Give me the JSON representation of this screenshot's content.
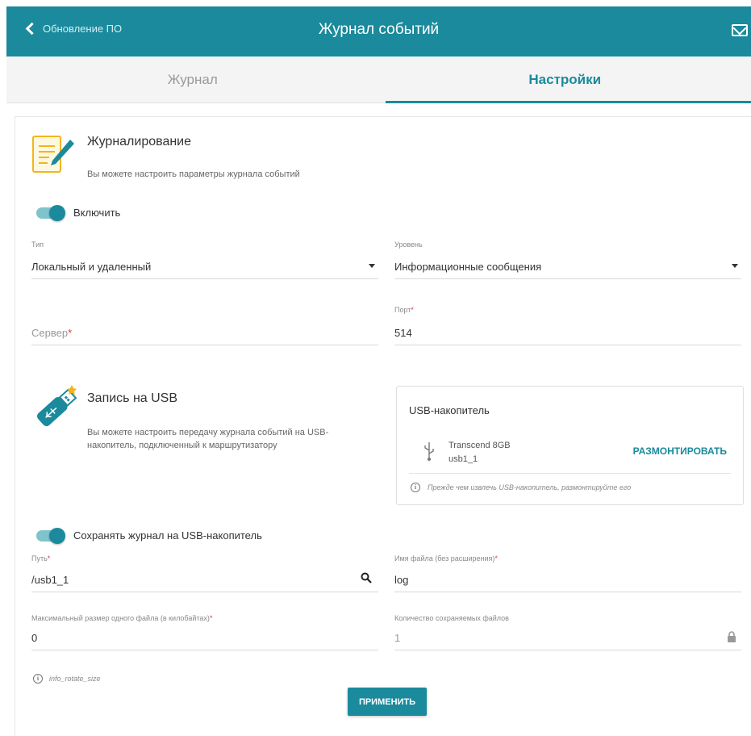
{
  "header": {
    "back_label": "Обновление ПО",
    "title": "Журнал событий"
  },
  "tabs": [
    {
      "label": "Журнал",
      "active": false
    },
    {
      "label": "Настройки",
      "active": true
    }
  ],
  "logging": {
    "title": "Журналирование",
    "description": "Вы можете настроить параметры журнала событий",
    "enable_label": "Включить",
    "enabled": true,
    "type": {
      "label": "Тип",
      "value": "Локальный и удаленный"
    },
    "level": {
      "label": "Уровень",
      "value": "Информационные сообщения"
    },
    "server": {
      "placeholder": "Сервер",
      "value": ""
    },
    "port": {
      "label": "Порт",
      "value": "514"
    }
  },
  "usb": {
    "title": "Запись на USB",
    "description_line1": "Вы можете настроить передачу журнала событий на USB-",
    "description_line2": "накопитель, подключенный к маршрутизатору",
    "box_title": "USB-накопитель",
    "device_name": "Transcend 8GB",
    "device_id": "usb1_1",
    "unmount_label": "РАЗМОНТИРОВАТЬ",
    "note": "Прежде чем извлечь USB-накопитель, размонтируйте его",
    "save_label": "Сохранять журнал на USB-накопитель",
    "save_enabled": true,
    "path": {
      "label": "Путь",
      "value": "/usb1_1"
    },
    "filename": {
      "label": "Имя файла (без расширения)",
      "value": "log"
    },
    "max_size": {
      "label": "Максимальный размер одного файла (в килобайтах)",
      "value": "0"
    },
    "files_count": {
      "label": "Количество сохраняемых файлов",
      "value": "1"
    },
    "hint": "info_rotate_size"
  },
  "apply_label": "ПРИМЕНИТЬ",
  "colors": {
    "accent": "#1a8a9c",
    "required": "#e2353a"
  }
}
